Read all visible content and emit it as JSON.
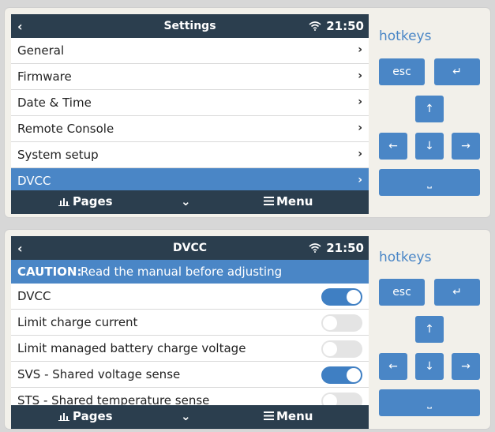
{
  "panels": [
    {
      "header": {
        "back": "‹",
        "title": "Settings",
        "time": "21:50"
      },
      "items": [
        {
          "label": "General",
          "chevron": "›"
        },
        {
          "label": "Firmware",
          "chevron": "›"
        },
        {
          "label": "Date & Time",
          "chevron": "›"
        },
        {
          "label": "Remote Console",
          "chevron": "›"
        },
        {
          "label": "System setup",
          "chevron": "›"
        },
        {
          "label": "DVCC",
          "chevron": "›",
          "selected": true
        }
      ],
      "footer": {
        "pages": "Pages",
        "caret": "⌄",
        "menu": "Menu"
      },
      "hotkeys": {
        "title": "hotkeys",
        "esc": "esc",
        "enter": "↵",
        "up": "↑",
        "left": "←",
        "down": "↓",
        "right": "→",
        "space": "⎵"
      }
    },
    {
      "header": {
        "back": "‹",
        "title": "DVCC",
        "time": "21:50"
      },
      "caution": {
        "strong": "CAUTION:",
        "text": "Read the manual before adjusting"
      },
      "items": [
        {
          "label": "DVCC",
          "enabled": true
        },
        {
          "label": "Limit charge current",
          "enabled": false
        },
        {
          "label": "Limit managed battery charge voltage",
          "enabled": false
        },
        {
          "label": "SVS - Shared voltage sense",
          "enabled": true
        },
        {
          "label": "STS - Shared temperature sense",
          "enabled": false
        }
      ],
      "footer": {
        "pages": "Pages",
        "caret": "⌄",
        "menu": "Menu"
      },
      "hotkeys": {
        "title": "hotkeys",
        "esc": "esc",
        "enter": "↵",
        "up": "↑",
        "left": "←",
        "down": "↓",
        "right": "→",
        "space": "⎵"
      }
    }
  ],
  "colors": {
    "accent": "#4a86c6",
    "bar": "#2b3e4e",
    "toggle_on": "#3f7fc3"
  },
  "icons": {
    "wifi": "wifi-icon",
    "pages": "bar-chart-icon",
    "menu": "hamburger-icon"
  }
}
